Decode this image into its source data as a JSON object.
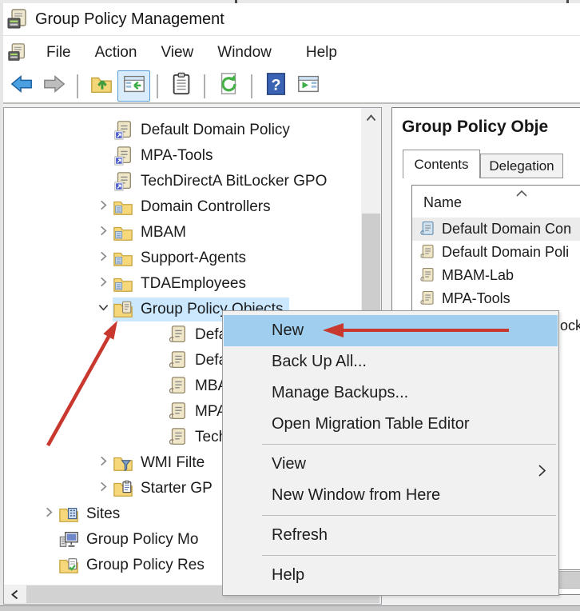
{
  "window": {
    "title": "Group Policy Management"
  },
  "menu_bar": [
    "File",
    "Action",
    "View",
    "Window",
    "Help"
  ],
  "toolbar": {
    "buttons": [
      {
        "icon": "back-arrow"
      },
      {
        "icon": "forward-arrow"
      },
      {
        "type": "separator"
      },
      {
        "icon": "folder-up"
      },
      {
        "icon": "console-tree",
        "active": true
      },
      {
        "type": "separator"
      },
      {
        "icon": "clipboard"
      },
      {
        "type": "separator"
      },
      {
        "icon": "refresh"
      },
      {
        "type": "separator"
      },
      {
        "icon": "help"
      },
      {
        "icon": "action-pane"
      }
    ]
  },
  "tree": [
    {
      "label": "Default Domain Policy",
      "icon": "gpo-link",
      "level": 1,
      "expander": "none"
    },
    {
      "label": "MPA-Tools",
      "icon": "gpo-link",
      "level": 1,
      "expander": "none"
    },
    {
      "label": "TechDirectA BitLocker GPO",
      "icon": "gpo-link",
      "level": 1,
      "expander": "none"
    },
    {
      "label": "Domain Controllers",
      "icon": "folder-ou",
      "level": 1,
      "expander": "collapsed"
    },
    {
      "label": "MBAM",
      "icon": "folder-ou",
      "level": 1,
      "expander": "collapsed"
    },
    {
      "label": "Support-Agents",
      "icon": "folder-ou",
      "level": 1,
      "expander": "collapsed"
    },
    {
      "label": "TDAEmployees",
      "icon": "folder-ou",
      "level": 1,
      "expander": "collapsed"
    },
    {
      "label": "Group Policy Objects",
      "icon": "folder-gpo",
      "level": 1,
      "expander": "expanded",
      "selected": true
    },
    {
      "label": "Defau",
      "icon": "gpo",
      "level": 2,
      "expander": "none"
    },
    {
      "label": "Defau",
      "icon": "gpo",
      "level": 2,
      "expander": "none"
    },
    {
      "label": "MBAM",
      "icon": "gpo",
      "level": 2,
      "expander": "none"
    },
    {
      "label": "MPA-",
      "icon": "gpo",
      "level": 2,
      "expander": "none"
    },
    {
      "label": "TechD",
      "icon": "gpo",
      "level": 2,
      "expander": "none"
    },
    {
      "label": "WMI Filte",
      "icon": "folder-wmi",
      "level": 1,
      "expander": "collapsed"
    },
    {
      "label": "Starter GP",
      "icon": "folder-starter",
      "level": 1,
      "expander": "collapsed"
    },
    {
      "label": "Sites",
      "icon": "folder-sites",
      "level": 0,
      "expander": "collapsed"
    },
    {
      "label": "Group Policy Mo",
      "icon": "gp-modeling",
      "level": 0,
      "expander": "none"
    },
    {
      "label": "Group Policy Res",
      "icon": "gp-results",
      "level": 0,
      "expander": "none"
    }
  ],
  "right_pane": {
    "title": "Group Policy Obje",
    "tabs": [
      {
        "label": "Contents",
        "active": true
      },
      {
        "label": "Delegation",
        "active": false
      }
    ],
    "list": {
      "column_header": "Name",
      "rows": [
        {
          "label": "Default Domain Con",
          "icon": "gpo-blue"
        },
        {
          "label": "Default Domain Poli",
          "icon": "gpo"
        },
        {
          "label": "MBAM-Lab",
          "icon": "gpo"
        },
        {
          "label": "MPA-Tools",
          "icon": "gpo"
        }
      ],
      "clipped_row_fragment": "ock"
    }
  },
  "context_menu": {
    "items": [
      {
        "label": "New",
        "highlighted": true
      },
      {
        "label": "Back Up All..."
      },
      {
        "label": "Manage Backups..."
      },
      {
        "label": "Open Migration Table Editor"
      },
      {
        "type": "separator"
      },
      {
        "label": "View",
        "submenu": true
      },
      {
        "label": "New Window from Here"
      },
      {
        "type": "separator"
      },
      {
        "label": "Refresh"
      },
      {
        "type": "separator"
      },
      {
        "label": "Help"
      }
    ]
  },
  "annotations": {
    "arrows": [
      {
        "name": "arrow-to-group-policy-objects"
      },
      {
        "name": "arrow-to-new-menu-item"
      }
    ]
  },
  "colors": {
    "tree_selection": "#cce8ff",
    "menu_highlight": "#9fceee",
    "toolbar_active_bg": "#d9ecfb",
    "annotation_red": "#c8382e"
  }
}
